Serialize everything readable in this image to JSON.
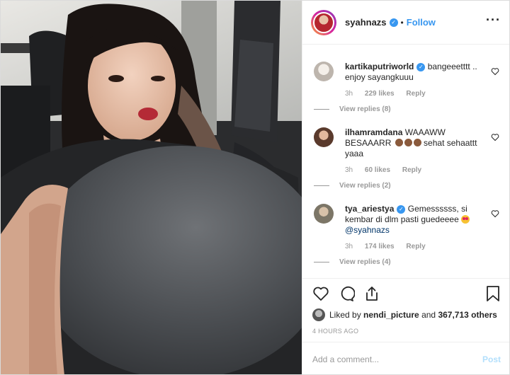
{
  "post": {
    "username": "syahnazs",
    "follow_label": "Follow",
    "separator": "•",
    "more_label": "···"
  },
  "comments": [
    {
      "username": "kartikaputriworld",
      "verified": true,
      "text": "bangeeetttt .. enjoy sayangkuuu",
      "time": "3h",
      "likes": "229 likes",
      "reply_label": "Reply",
      "view_replies": "View replies (8)",
      "avatar_color": "#d9d4cf"
    },
    {
      "username": "ilhamramdana",
      "verified": false,
      "text": "WAAAWW BESAAARR",
      "text_after": "sehat sehaattt yaaa",
      "time": "3h",
      "likes": "60 likes",
      "reply_label": "Reply",
      "view_replies": "View replies (2)",
      "avatar_color": "#6b4a3a"
    },
    {
      "username": "tya_ariestya",
      "verified": true,
      "text": "Gemessssss, si kembar di dlm pasti guedeeee",
      "mention": "@syahnazs",
      "time": "3h",
      "likes": "174 likes",
      "reply_label": "Reply",
      "view_replies": "View replies (4)",
      "avatar_color": "#8d8a7e"
    }
  ],
  "engagement": {
    "liked_by_prefix": "Liked by",
    "liked_by_user": "nendi_picture",
    "liked_by_and": "and",
    "liked_by_count": "367,713 others",
    "timestamp": "4 HOURS AGO"
  },
  "composer": {
    "placeholder": "Add a comment...",
    "post_label": "Post"
  },
  "colors": {
    "accent": "#3897f0",
    "post_disabled": "#b2dffc",
    "muted": "#999999"
  },
  "icons": [
    "heart-icon",
    "comment-icon",
    "share-icon",
    "bookmark-icon",
    "verified-icon",
    "more-options-icon"
  ]
}
